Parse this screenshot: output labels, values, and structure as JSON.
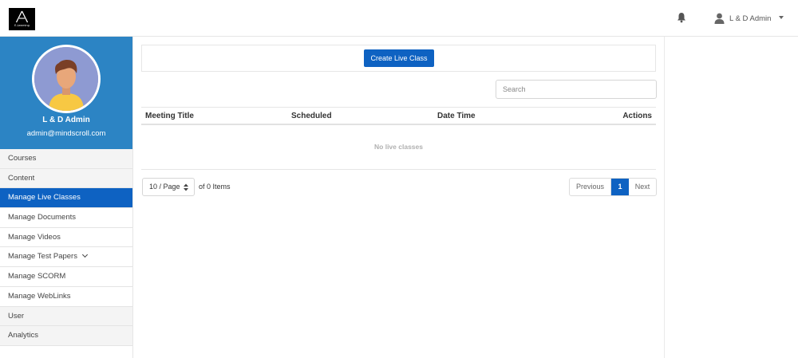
{
  "brand": {
    "logo_text": "E-Learning"
  },
  "header": {
    "user_name": "L & D Admin"
  },
  "profile": {
    "name": "L & D Admin",
    "email": "admin@mindscroll.com"
  },
  "sidebar": {
    "items": [
      {
        "label": "Courses"
      },
      {
        "label": "Content"
      },
      {
        "label": "Manage Live Classes"
      },
      {
        "label": "Manage Documents"
      },
      {
        "label": "Manage Videos"
      },
      {
        "label": "Manage Test Papers"
      },
      {
        "label": "Manage SCORM"
      },
      {
        "label": "Manage WebLinks"
      },
      {
        "label": "User"
      },
      {
        "label": "Analytics"
      }
    ]
  },
  "main": {
    "create_button": "Create Live Class",
    "search_placeholder": "Search",
    "table": {
      "columns": [
        "Meeting Title",
        "Scheduled",
        "Date Time",
        "Actions"
      ],
      "empty_message": "No live classes"
    },
    "pagination": {
      "page_size": "10 / Page",
      "item_count": "of 0 Items",
      "previous": "Previous",
      "current": "1",
      "next": "Next"
    }
  },
  "colors": {
    "primary": "#0e62c2",
    "sidebar_profile_bg": "#2c84c4"
  }
}
